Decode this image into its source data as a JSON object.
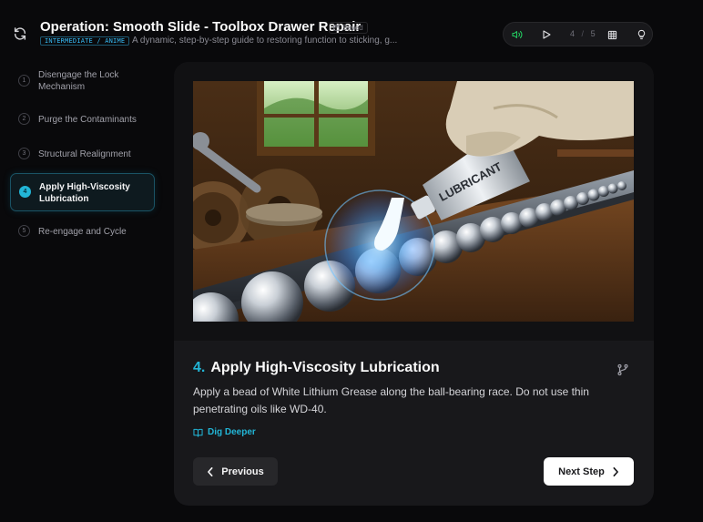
{
  "header": {
    "title": "Operation: Smooth Slide - Toolbox Drawer Repair",
    "saved_label": "Saved",
    "tag": "INTERMEDIATE / ANIME",
    "subtitle": "A dynamic, step-by-step guide to restoring function to sticking, g...",
    "refresh_icon": "refresh-icon"
  },
  "controls": {
    "current": "4",
    "separator": "/",
    "total": "5",
    "icons": [
      "volume-icon",
      "play-icon",
      "grid-icon",
      "lightbulb-icon"
    ],
    "accent": "#22c55e"
  },
  "sidebar": {
    "items": [
      {
        "num": "1",
        "label": "Disengage the Lock Mechanism"
      },
      {
        "num": "2",
        "label": "Purge the Contaminants"
      },
      {
        "num": "3",
        "label": "Structural Realignment"
      },
      {
        "num": "4",
        "label": "Apply High-Viscosity Lubrication",
        "active": true
      },
      {
        "num": "5",
        "label": "Re-engage and Cycle"
      }
    ]
  },
  "step": {
    "number": "4.",
    "title": "Apply High-Viscosity Lubrication",
    "description": "Apply a bead of White Lithium Grease along the ball-bearing race. Do not use thin penetrating oils like WD-40.",
    "dig_deeper": "Dig Deeper",
    "image_tube_label": "LUBRICANT"
  },
  "nav": {
    "previous": "Previous",
    "next": "Next Step"
  },
  "colors": {
    "accent": "#22b5d6",
    "background": "#09090b",
    "card": "#18181b"
  }
}
